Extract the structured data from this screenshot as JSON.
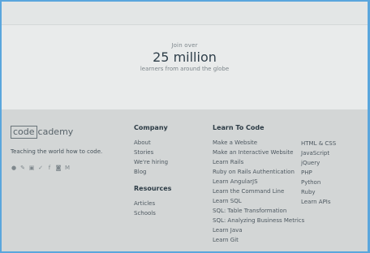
{
  "stats": {
    "prefix": "Join over",
    "count": "25 million",
    "suffix": "learners from around the globe"
  },
  "footer": {
    "logo": {
      "left": "code",
      "right": "cademy"
    },
    "tagline": "Teaching the world how to code.",
    "social_icons": [
      "reddit-icon",
      "google-icon",
      "youtube-icon",
      "twitter-icon",
      "facebook-icon",
      "instagram-icon",
      "medium-icon"
    ],
    "company": {
      "heading": "Company",
      "links": [
        "About",
        "Stories",
        "We're hiring",
        "Blog"
      ]
    },
    "resources": {
      "heading": "Resources",
      "links": [
        "Articles",
        "Schools"
      ]
    },
    "learn": {
      "heading": "Learn To Code",
      "col1": [
        "Make a Website",
        "Make an Interactive Website",
        "Learn Rails",
        "Ruby on Rails Authentication",
        "Learn AngularJS",
        "Learn the Command Line",
        "Learn SQL",
        "SQL: Table Transformation",
        "SQL: Analyzing Business Metrics",
        "Learn Java",
        "Learn Git"
      ],
      "col2": [
        "HTML & CSS",
        "JavaScript",
        "jQuery",
        "PHP",
        "Python",
        "Ruby",
        "Learn APIs"
      ]
    }
  }
}
